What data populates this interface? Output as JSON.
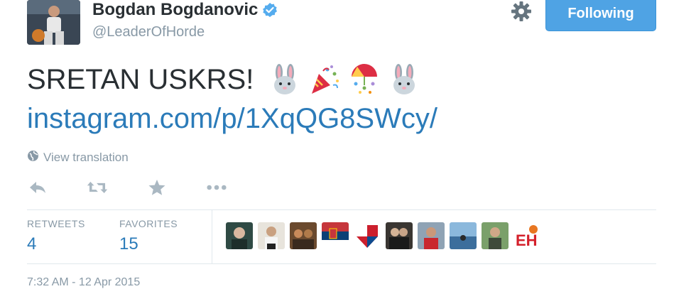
{
  "profile": {
    "name": "Bogdan Bogdanovic",
    "handle": "@LeaderOfHorde",
    "verified": true
  },
  "header": {
    "follow_label": "Following",
    "settings_icon": "gear-icon"
  },
  "tweet": {
    "text": "SRETAN USKRS!",
    "emojis": [
      "rabbit-face-icon",
      "party-popper-icon",
      "confetti-ball-icon",
      "rabbit-face-icon"
    ],
    "link": "instagram.com/p/1XqQG8SWcy/",
    "translation_label": "View translation"
  },
  "actions": [
    "reply-icon",
    "retweet-icon",
    "favorite-star-icon",
    "more-icon"
  ],
  "stats": {
    "retweets_label": "RETWEETS",
    "retweets_count": "4",
    "favorites_label": "FAVORITES",
    "favorites_count": "15",
    "favoriters_count": 10
  },
  "timestamp": "7:32 AM - 12 Apr 2015",
  "colors": {
    "link": "#2b7bb9",
    "button": "#4fa3e4",
    "muted": "#8899a6",
    "text": "#292f33",
    "divider": "#e1e8ed"
  }
}
